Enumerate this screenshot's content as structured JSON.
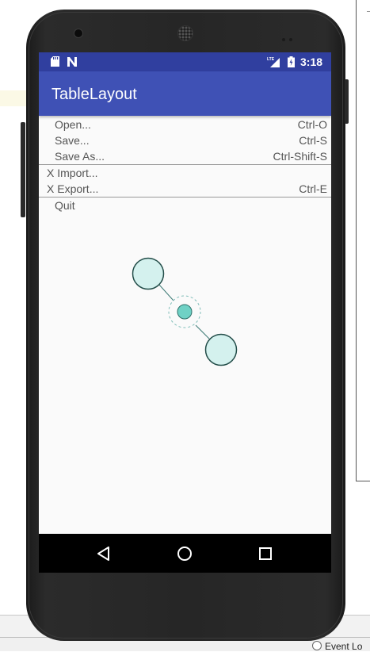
{
  "status_bar": {
    "time": "3:18",
    "icons": [
      "sd-card-icon",
      "n-notification-icon",
      "lte-signal-icon",
      "battery-charging-icon"
    ]
  },
  "app_bar": {
    "title": "TableLayout",
    "color": "#3f51b5",
    "status_color": "#303f9f"
  },
  "menu": {
    "group1": [
      {
        "label": "Open...",
        "shortcut": "Ctrl-O"
      },
      {
        "label": "Save...",
        "shortcut": "Ctrl-S"
      },
      {
        "label": "Save As...",
        "shortcut": "Ctrl-Shift-S"
      }
    ],
    "group2": [
      {
        "label": "X Import...",
        "shortcut": ""
      },
      {
        "label": "X Export...",
        "shortcut": "Ctrl-E"
      }
    ],
    "group3": [
      {
        "label": "Quit",
        "shortcut": ""
      }
    ]
  },
  "nav_bar": {
    "buttons": [
      "back-icon",
      "home-icon",
      "recent-apps-icon"
    ]
  },
  "ide": {
    "event_log_label": "Event Lo"
  }
}
